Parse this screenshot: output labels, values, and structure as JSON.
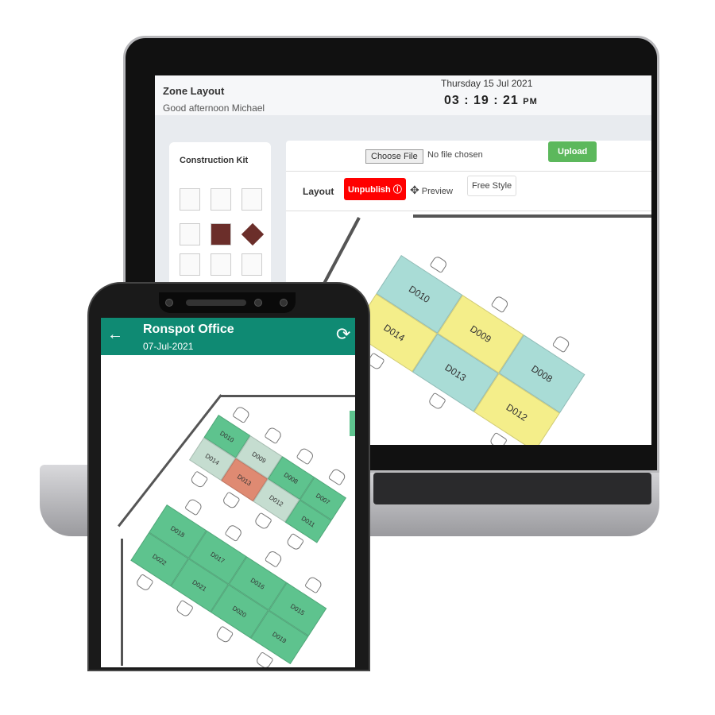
{
  "laptop": {
    "header": {
      "title": "Zone Layout",
      "greeting": "Good afternoon Michael",
      "date": "Thursday 15 Jul 2021",
      "time": "03 : 19 : 21",
      "ampm": "PM"
    },
    "kit": {
      "title": "Construction Kit"
    },
    "upload": {
      "choose_label": "Choose File",
      "no_file": "No file chosen",
      "upload_label": "Upload"
    },
    "toolbar": {
      "layout_label": "Layout",
      "unpublish_label": "Unpublish",
      "preview_label": "Preview",
      "free_style_label": "Free Style"
    },
    "desks": [
      {
        "id": "D010",
        "status": "teal"
      },
      {
        "id": "D009",
        "status": "yellow"
      },
      {
        "id": "D008",
        "status": "teal"
      },
      {
        "id": "D014",
        "status": "yellow"
      },
      {
        "id": "D013",
        "status": "teal"
      },
      {
        "id": "D012",
        "status": "yellow"
      }
    ]
  },
  "phone": {
    "title": "Ronspot Office",
    "date": "07-Jul-2021",
    "cluster1": [
      {
        "id": "D010",
        "status": "available"
      },
      {
        "id": "D009",
        "status": "partial"
      },
      {
        "id": "D008",
        "status": "available"
      },
      {
        "id": "D007",
        "status": "available"
      },
      {
        "id": "D014",
        "status": "partial"
      },
      {
        "id": "D013",
        "status": "booked"
      },
      {
        "id": "D012",
        "status": "partial"
      },
      {
        "id": "D011",
        "status": "available"
      }
    ],
    "cluster2": [
      {
        "id": "D018",
        "status": "available"
      },
      {
        "id": "D017",
        "status": "available"
      },
      {
        "id": "D016",
        "status": "available"
      },
      {
        "id": "D015",
        "status": "available"
      },
      {
        "id": "D022",
        "status": "available"
      },
      {
        "id": "D021",
        "status": "available"
      },
      {
        "id": "D020",
        "status": "available"
      },
      {
        "id": "D019",
        "status": "available"
      }
    ]
  },
  "colors": {
    "teal": "#a9dcd6",
    "yellow": "#f4ee8a",
    "available": "#5ec38e",
    "partial": "#c5ddd0",
    "booked": "#df8a72",
    "header": "#0f8a73",
    "upload": "#5cb85c",
    "unpublish": "#ff0000"
  }
}
